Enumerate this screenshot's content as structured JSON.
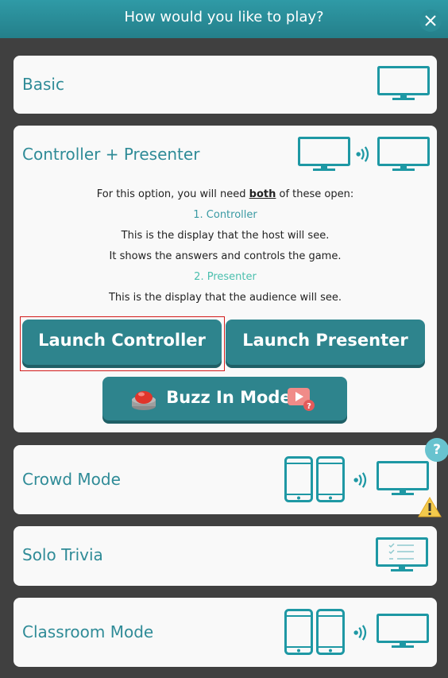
{
  "header": {
    "title": "How would you like to play?"
  },
  "options": {
    "basic": {
      "label": "Basic"
    },
    "controller_presenter": {
      "label": "Controller + Presenter",
      "intro_pre": "For this option, you will need ",
      "intro_bold": "both",
      "intro_post": " of these open:",
      "controller_heading": "1. Controller",
      "controller_line1": "This is the display that the host will see.",
      "controller_line2": "It shows the answers and controls the game.",
      "presenter_heading": "2. Presenter",
      "presenter_line1": "This is the display that the audience will see.",
      "launch_controller": "Launch Controller",
      "launch_presenter": "Launch Presenter",
      "buzz_in": "Buzz In Mode"
    },
    "crowd": {
      "label": "Crowd Mode"
    },
    "solo": {
      "label": "Solo Trivia"
    },
    "classroom": {
      "label": "Classroom Mode"
    }
  },
  "help_badge": "?",
  "colors": {
    "teal": "#2f8b97",
    "button": "#2e848d",
    "header": "#2a8c97",
    "warning": "#f2c94c"
  }
}
